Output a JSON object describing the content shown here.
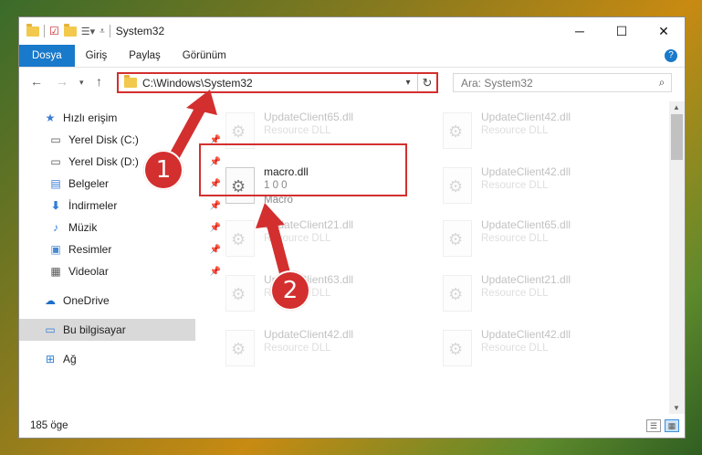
{
  "window": {
    "title": "System32"
  },
  "ribbon": {
    "tabs": [
      "Dosya",
      "Giriş",
      "Paylaş",
      "Görünüm"
    ]
  },
  "address": {
    "path": "C:\\Windows\\System32"
  },
  "search": {
    "placeholder": "Ara: System32"
  },
  "sidebar": {
    "items": [
      {
        "label": "Hızlı erişim",
        "icon": "star-icon"
      },
      {
        "label": "Yerel Disk (C:)",
        "icon": "drive-icon"
      },
      {
        "label": "Yerel Disk (D:)",
        "icon": "drive-icon"
      },
      {
        "label": "Belgeler",
        "icon": "document-icon"
      },
      {
        "label": "İndirmeler",
        "icon": "download-icon"
      },
      {
        "label": "Müzik",
        "icon": "music-icon"
      },
      {
        "label": "Resimler",
        "icon": "pictures-icon"
      },
      {
        "label": "Videolar",
        "icon": "video-icon"
      },
      {
        "label": "OneDrive",
        "icon": "cloud-icon"
      },
      {
        "label": "Bu bilgisayar",
        "icon": "computer-icon"
      },
      {
        "label": "Ağ",
        "icon": "network-icon"
      }
    ]
  },
  "files": [
    {
      "name": "UpdateClient65.dll",
      "line2": "Resource DLL",
      "line3": ""
    },
    {
      "name": "UpdateClient42.dll",
      "line2": "Resource DLL",
      "line3": ""
    },
    {
      "name": "macro.dll",
      "line2": "1 0 0",
      "line3": "Macro"
    },
    {
      "name": "UpdateClient42.dll",
      "line2": "Resource DLL",
      "line3": ""
    },
    {
      "name": "UpdateClient21.dll",
      "line2": "Resource DLL",
      "line3": ""
    },
    {
      "name": "UpdateClient65.dll",
      "line2": "Resource DLL",
      "line3": ""
    },
    {
      "name": "UpdateClient63.dll",
      "line2": "Resource DLL",
      "line3": ""
    },
    {
      "name": "UpdateClient21.dll",
      "line2": "Resource DLL",
      "line3": ""
    },
    {
      "name": "UpdateClient42.dll",
      "line2": "Resource DLL",
      "line3": ""
    },
    {
      "name": "UpdateClient42.dll",
      "line2": "Resource DLL",
      "line3": ""
    }
  ],
  "status": {
    "count": "185 öge"
  },
  "annotations": {
    "step1": "1",
    "step2": "2",
    "color": "#d32f2f"
  }
}
